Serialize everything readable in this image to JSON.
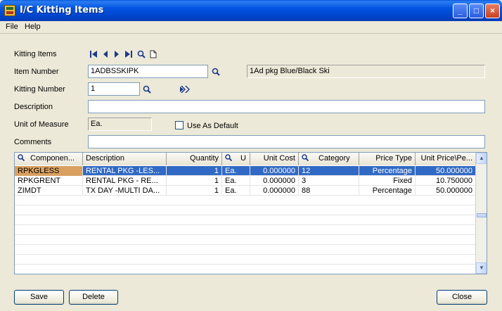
{
  "window": {
    "title": "I/C Kitting Items"
  },
  "menu": {
    "file": "File",
    "help": "Help"
  },
  "form": {
    "kitting_items_label": "Kitting Items",
    "item_number_label": "Item Number",
    "item_number_value": "1ADBSSKIPK",
    "item_description_value": "1Ad pkg Blue/Black Ski",
    "kitting_number_label": "Kitting Number",
    "kitting_number_value": "1",
    "description_label": "Description",
    "description_value": "",
    "uom_label": "Unit of Measure",
    "uom_value": "Ea.",
    "use_as_default_label": "Use As Default",
    "use_as_default_checked": false,
    "comments_label": "Comments",
    "comments_value": ""
  },
  "grid": {
    "columns": [
      "Componen...",
      "Description",
      "Quantity",
      "U",
      "Unit Cost",
      "Category",
      "Price Type",
      "Unit Price\\Pe..."
    ],
    "rows": [
      {
        "component": "RPKGLESS",
        "description": "RENTAL PKG -LES...",
        "quantity": "1",
        "uom": "Ea.",
        "unit_cost": "0.000000",
        "category": "12",
        "price_type": "Percentage",
        "unit_price": "50.000000"
      },
      {
        "component": "RPKGRENT",
        "description": "RENTAL  PKG - RE...",
        "quantity": "1",
        "uom": "Ea.",
        "unit_cost": "0.000000",
        "category": "3",
        "price_type": "Fixed",
        "unit_price": "10.750000"
      },
      {
        "component": "ZIMDT",
        "description": "TX DAY -MULTI DA...",
        "quantity": "1",
        "uom": "Ea.",
        "unit_cost": "0.000000",
        "category": "88",
        "price_type": "Percentage",
        "unit_price": "50.000000"
      }
    ]
  },
  "buttons": {
    "save": "Save",
    "delete": "Delete",
    "close": "Close"
  },
  "icons": [
    "app-icon",
    "minimize-icon",
    "maximize-icon",
    "close-icon",
    "first-record-icon",
    "previous-record-icon",
    "next-record-icon",
    "last-record-icon",
    "finder-icon",
    "new-document-icon",
    "drilldown-icon"
  ]
}
